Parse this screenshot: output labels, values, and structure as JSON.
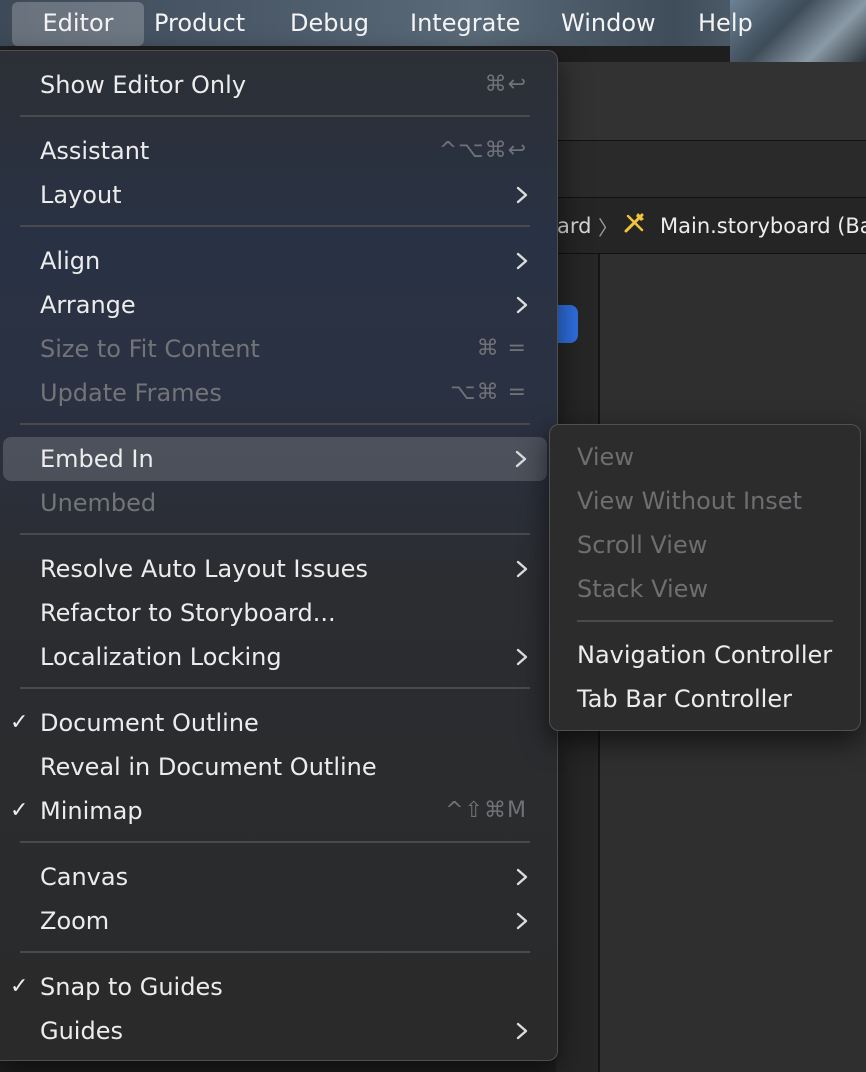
{
  "menubar": {
    "items": [
      "Editor",
      "Product",
      "Debug",
      "Integrate",
      "Window",
      "Help"
    ],
    "active_index": 0
  },
  "background": {
    "jump_bar_fragment": "ard",
    "jump_bar_separator": "〉",
    "jump_bar_title": "Main.storyboard (Ba",
    "storyboard_icon": "storyboard-icon"
  },
  "menu": {
    "items": [
      {
        "label": "Show Editor Only",
        "shortcut": "⌘↩",
        "checked": false,
        "disabled": false,
        "submenu": false
      },
      {
        "label": "Assistant",
        "shortcut": "^⌥⌘↩",
        "checked": false,
        "disabled": false,
        "submenu": false
      },
      {
        "label": "Layout",
        "shortcut": "",
        "checked": false,
        "disabled": false,
        "submenu": true
      },
      {
        "label": "Align",
        "shortcut": "",
        "checked": false,
        "disabled": false,
        "submenu": true
      },
      {
        "label": "Arrange",
        "shortcut": "",
        "checked": false,
        "disabled": false,
        "submenu": true
      },
      {
        "label": "Size to Fit Content",
        "shortcut": "⌘ =",
        "checked": false,
        "disabled": true,
        "submenu": false
      },
      {
        "label": "Update Frames",
        "shortcut": "⌥⌘ =",
        "checked": false,
        "disabled": true,
        "submenu": false
      },
      {
        "label": "Embed In",
        "shortcut": "",
        "checked": false,
        "disabled": false,
        "submenu": true,
        "selected": true
      },
      {
        "label": "Unembed",
        "shortcut": "",
        "checked": false,
        "disabled": true,
        "submenu": false
      },
      {
        "label": "Resolve Auto Layout Issues",
        "shortcut": "",
        "checked": false,
        "disabled": false,
        "submenu": true
      },
      {
        "label": "Refactor to Storyboard...",
        "shortcut": "",
        "checked": false,
        "disabled": false,
        "submenu": false
      },
      {
        "label": "Localization Locking",
        "shortcut": "",
        "checked": false,
        "disabled": false,
        "submenu": true
      },
      {
        "label": "Document Outline",
        "shortcut": "",
        "checked": true,
        "disabled": false,
        "submenu": false
      },
      {
        "label": "Reveal in Document Outline",
        "shortcut": "",
        "checked": false,
        "disabled": false,
        "submenu": false
      },
      {
        "label": "Minimap",
        "shortcut": "^⇧⌘M",
        "checked": true,
        "disabled": false,
        "submenu": false
      },
      {
        "label": "Canvas",
        "shortcut": "",
        "checked": false,
        "disabled": false,
        "submenu": true
      },
      {
        "label": "Zoom",
        "shortcut": "",
        "checked": false,
        "disabled": false,
        "submenu": true
      },
      {
        "label": "Snap to Guides",
        "shortcut": "",
        "checked": true,
        "disabled": false,
        "submenu": false
      },
      {
        "label": "Guides",
        "shortcut": "",
        "checked": false,
        "disabled": false,
        "submenu": true
      }
    ],
    "check_glyph": "✓"
  },
  "submenu": {
    "parent": "Embed In",
    "items": [
      {
        "label": "View",
        "disabled": true
      },
      {
        "label": "View Without Inset",
        "disabled": true
      },
      {
        "label": "Scroll View",
        "disabled": true
      },
      {
        "label": "Stack View",
        "disabled": true
      },
      {
        "label": "Navigation Controller",
        "disabled": false
      },
      {
        "label": "Tab Bar Controller",
        "disabled": false
      }
    ]
  },
  "colors": {
    "text": "#ececec",
    "disabled_text": "#727477",
    "accent_blue": "#2f6fe0",
    "storyboard_icon": "#f2c43a"
  }
}
